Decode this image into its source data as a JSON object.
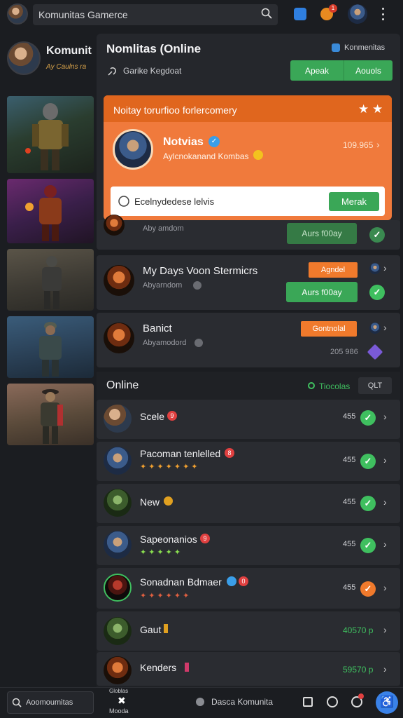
{
  "topbar": {
    "search_placeholder": "Komunitas Gamerce",
    "badge_count": "1"
  },
  "left": {
    "profile_name": "Komunit",
    "profile_sub": "Ay Caulns ra",
    "thumbnails": [
      "soldier-armor",
      "red-demon",
      "street-soldier",
      "rain-soldier",
      "fedora-gunman"
    ]
  },
  "panel": {
    "title": "Nomlitas (Online",
    "owner_label": "Konmenitas",
    "subtitle": "Garike Kegdoat",
    "tab_a": "Apeak",
    "tab_b": "Aouols"
  },
  "promo": {
    "title": "Noitay torurfioo forlercomery",
    "user_name": "Notvias",
    "user_sub": "Aylcnokanand Kombas",
    "value": "109.965",
    "input_value": "Ecelnydedese lelvis",
    "button": "Merak"
  },
  "feed": [
    {
      "title": "",
      "sub": "Aby amdom",
      "tag": "",
      "action": "Aurs f00ay"
    },
    {
      "title": "My Days Voon Stermicrs",
      "sub": "Abyarndom",
      "tag": "Agndel",
      "action": "Aurs f00ay"
    },
    {
      "title": "Banict",
      "sub": "Abyamodord",
      "tag": "Gontnolal",
      "value": "205 986"
    }
  ],
  "online": {
    "header": "Online",
    "status": "Tiocolas",
    "button": "QLT",
    "users": [
      {
        "name": "Scele",
        "badge": "9",
        "count": "455"
      },
      {
        "name": "Pacoman tenlelled",
        "badge": "8",
        "count": "455",
        "icons": "✦✦✦✦✦✦✦"
      },
      {
        "name": "New",
        "badge": "",
        "count": "455"
      },
      {
        "name": "Sapeonanios",
        "badge": "9",
        "count": "455",
        "icons": "✦✦✦✦✦"
      },
      {
        "name": "Sonadnan Bdmaer",
        "badge": "0",
        "count": "455",
        "icons": "✦✦✦✦✦✦"
      },
      {
        "name": "Gaut",
        "badge": "",
        "count": "40570 p"
      },
      {
        "name": "Kenders",
        "badge": "",
        "count": "59570 p"
      }
    ]
  },
  "bottom": {
    "search": "Aoomoumitas",
    "center_top": "Globlas",
    "center_bottom": "Mooda",
    "discover": "Dasca Komunita"
  },
  "colors": {
    "accent_orange": "#f07a2c",
    "accent_green": "#3aa757",
    "accent_blue": "#3a82e8"
  }
}
